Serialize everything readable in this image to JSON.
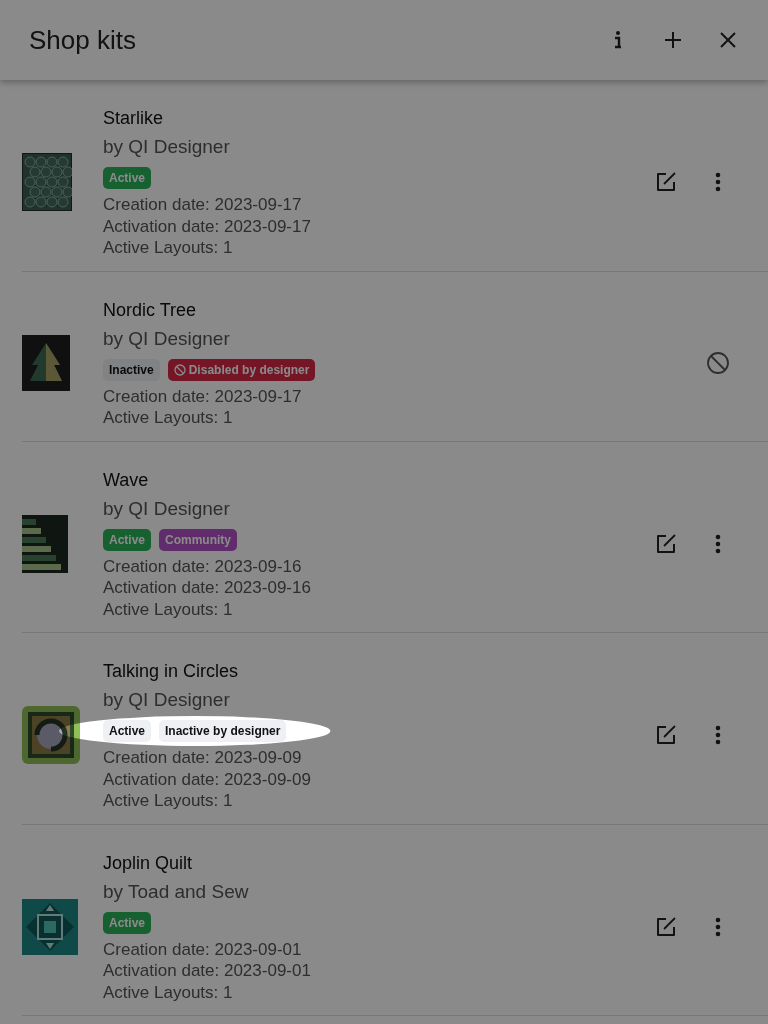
{
  "header": {
    "title": "Shop kits",
    "actions": [
      {
        "kind": "info"
      },
      {
        "kind": "add"
      },
      {
        "kind": "close"
      }
    ]
  },
  "kits": [
    {
      "name": "Starlike",
      "designer": "by QI Designer",
      "spotlight": false,
      "badges": [
        {
          "label": "Active",
          "kind": "active"
        }
      ],
      "details": [
        "Creation date: 2023-09-17",
        "Activation date: 2023-09-17",
        "Active Layouts: 1"
      ],
      "actions": [
        {
          "kind": "edit"
        },
        {
          "kind": "more"
        }
      ]
    },
    {
      "name": "Nordic Tree",
      "designer": "by QI Designer",
      "spotlight": false,
      "badges": [
        {
          "label": "Inactive",
          "kind": "neutral"
        },
        {
          "label": "Disabled by designer",
          "kind": "disabled"
        }
      ],
      "details": [
        "Creation date: 2023-09-17",
        "Active Layouts: 1"
      ],
      "actions": [
        {
          "kind": "blocked"
        }
      ]
    },
    {
      "name": "Wave",
      "designer": "by QI Designer",
      "spotlight": false,
      "badges": [
        {
          "label": "Active",
          "kind": "active"
        },
        {
          "label": "Community",
          "kind": "community"
        }
      ],
      "details": [
        "Creation date: 2023-09-16",
        "Activation date: 2023-09-16",
        "Active Layouts: 1"
      ],
      "actions": [
        {
          "kind": "edit"
        },
        {
          "kind": "more"
        }
      ]
    },
    {
      "name": "Talking in Circles",
      "designer": "by QI Designer",
      "spotlight": true,
      "badges": [
        {
          "label": "Active",
          "kind": "neutral"
        },
        {
          "label": "Inactive by designer",
          "kind": "neutral"
        }
      ],
      "details": [
        "Creation date: 2023-09-09",
        "Activation date: 2023-09-09",
        "Active Layouts: 1"
      ],
      "actions": [
        {
          "kind": "edit"
        },
        {
          "kind": "more"
        }
      ]
    },
    {
      "name": "Joplin Quilt",
      "designer": "by Toad and Sew",
      "spotlight": false,
      "badges": [
        {
          "label": "Active",
          "kind": "active"
        }
      ],
      "details": [
        "Creation date: 2023-09-01",
        "Activation date: 2023-09-01",
        "Active Layouts: 1"
      ],
      "actions": [
        {
          "kind": "edit"
        },
        {
          "kind": "more"
        }
      ]
    }
  ]
}
